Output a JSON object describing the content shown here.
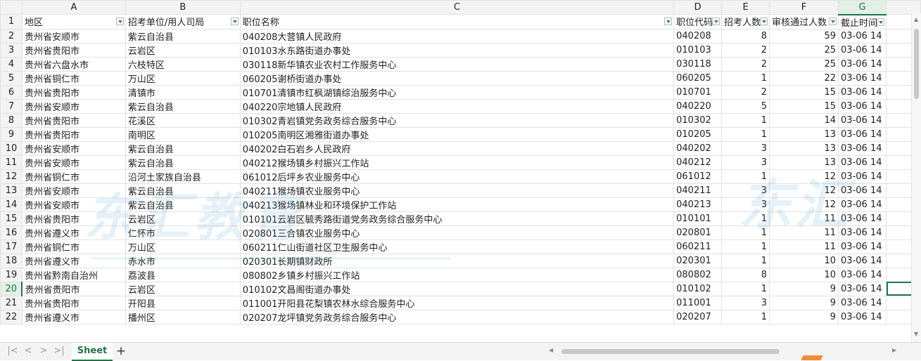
{
  "columns": [
    "A",
    "B",
    "C",
    "D",
    "E",
    "F",
    "G"
  ],
  "selected_column": "G",
  "selected_row": "20",
  "headers": [
    "地区",
    "招考单位/用人司局",
    "职位名称",
    "职位代码",
    "招考人数",
    "审核通过人数",
    "截止时间"
  ],
  "rows": [
    {
      "n": "2",
      "a": "贵州省安顺市",
      "b": "紫云自治县",
      "c": "040208大营镇人民政府",
      "d": "040208",
      "e": "8",
      "f": "59",
      "g": "03-06 14"
    },
    {
      "n": "3",
      "a": "贵州省贵阳市",
      "b": "云岩区",
      "c": "010103水东路街道办事处",
      "d": "010103",
      "e": "2",
      "f": "25",
      "g": "03-06 14"
    },
    {
      "n": "4",
      "a": "贵州省六盘水市",
      "b": "六枝特区",
      "c": "030118新华镇农业农村工作服务中心",
      "d": "030118",
      "e": "2",
      "f": "25",
      "g": "03-06 14"
    },
    {
      "n": "5",
      "a": "贵州省铜仁市",
      "b": "万山区",
      "c": "060205谢桥街道办事处",
      "d": "060205",
      "e": "1",
      "f": "22",
      "g": "03-06 14"
    },
    {
      "n": "6",
      "a": "贵州省贵阳市",
      "b": "清镇市",
      "c": "010701清镇市红枫湖镇综治服务中心",
      "d": "010701",
      "e": "2",
      "f": "15",
      "g": "03-06 14"
    },
    {
      "n": "7",
      "a": "贵州省安顺市",
      "b": "紫云自治县",
      "c": "040220宗地镇人民政府",
      "d": "040220",
      "e": "5",
      "f": "15",
      "g": "03-06 14"
    },
    {
      "n": "8",
      "a": "贵州省贵阳市",
      "b": "花溪区",
      "c": "010302青岩镇党务政务综合服务中心",
      "d": "010302",
      "e": "1",
      "f": "14",
      "g": "03-06 14"
    },
    {
      "n": "9",
      "a": "贵州省贵阳市",
      "b": "南明区",
      "c": "010205南明区湘雅街道办事处",
      "d": "010205",
      "e": "1",
      "f": "13",
      "g": "03-06 14"
    },
    {
      "n": "10",
      "a": "贵州省安顺市",
      "b": "紫云自治县",
      "c": "040202白石岩乡人民政府",
      "d": "040202",
      "e": "3",
      "f": "13",
      "g": "03-06 14"
    },
    {
      "n": "11",
      "a": "贵州省安顺市",
      "b": "紫云自治县",
      "c": "040212猴场镇乡村振兴工作站",
      "d": "040212",
      "e": "3",
      "f": "13",
      "g": "03-06 14"
    },
    {
      "n": "12",
      "a": "贵州省铜仁市",
      "b": "沿河土家族自治县",
      "c": "061012后坪乡农业服务中心",
      "d": "061012",
      "e": "1",
      "f": "12",
      "g": "03-06 14"
    },
    {
      "n": "13",
      "a": "贵州省安顺市",
      "b": "紫云自治县",
      "c": "040211猴场镇农业服务中心",
      "d": "040211",
      "e": "3",
      "f": "12",
      "g": "03-06 14"
    },
    {
      "n": "14",
      "a": "贵州省安顺市",
      "b": "紫云自治县",
      "c": "040213猴场镇林业和环境保护工作站",
      "d": "040213",
      "e": "3",
      "f": "12",
      "g": "03-06 14"
    },
    {
      "n": "15",
      "a": "贵州省贵阳市",
      "b": "云岩区",
      "c": "010101云岩区毓秀路街道党务政务综合服务中心",
      "d": "010101",
      "e": "1",
      "f": "11",
      "g": "03-06 14"
    },
    {
      "n": "16",
      "a": "贵州省遵义市",
      "b": "仁怀市",
      "c": "020801三合镇农业服务中心",
      "d": "020801",
      "e": "1",
      "f": "11",
      "g": "03-06 14"
    },
    {
      "n": "17",
      "a": "贵州省铜仁市",
      "b": "万山区",
      "c": "060211仁山街道社区卫生服务中心",
      "d": "060211",
      "e": "1",
      "f": "11",
      "g": "03-06 14"
    },
    {
      "n": "18",
      "a": "贵州省遵义市",
      "b": "赤水市",
      "c": "020301长期镇财政所",
      "d": "020301",
      "e": "1",
      "f": "10",
      "g": "03-06 14"
    },
    {
      "n": "19",
      "a": "贵州省黔南自治州",
      "b": "荔波县",
      "c": "080802乡镇乡村振兴工作站",
      "d": "080802",
      "e": "8",
      "f": "10",
      "g": "03-06 14"
    },
    {
      "n": "20",
      "a": "贵州省贵阳市",
      "b": "云岩区",
      "c": "010102文昌阁街道办事处",
      "d": "010102",
      "e": "1",
      "f": "9",
      "g": "03-06 14"
    },
    {
      "n": "21",
      "a": "贵州省贵阳市",
      "b": "开阳县",
      "c": "011001开阳县花梨镇农林水综合服务中心",
      "d": "011001",
      "e": "3",
      "f": "9",
      "g": "03-06 14"
    },
    {
      "n": "22",
      "a": "贵州省遵义市",
      "b": "播州区",
      "c": "020207龙坪镇党务政务综合服务中心",
      "d": "020207",
      "e": "1",
      "f": "9",
      "g": "03-06 14"
    }
  ],
  "sheet_tab": "Sheet",
  "add_tab": "+",
  "watermark": [
    "东汇教育",
    "东汇"
  ],
  "nav_icons": [
    "first-sheet-icon",
    "prev-sheet-icon",
    "next-sheet-icon",
    "last-sheet-icon"
  ],
  "colors": {
    "accent": "#217346",
    "grid": "#e1e1e1",
    "header_bg": "#f3f3f3",
    "watermark": "#5fa0d2"
  }
}
